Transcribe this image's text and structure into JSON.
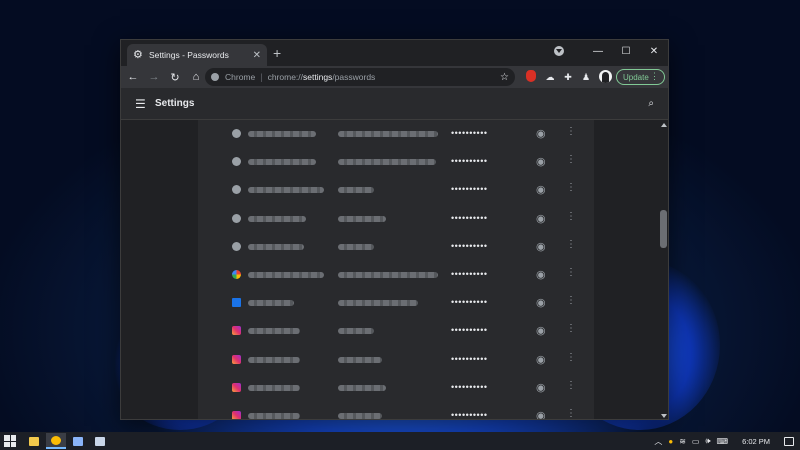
{
  "browser": {
    "tab_title": "Settings - Passwords",
    "omnibox_chip": "Chrome",
    "url_prefix": "chrome://",
    "url_bold": "settings",
    "url_suffix": "/passwords",
    "update_label": "Update"
  },
  "settings": {
    "title": "Settings"
  },
  "passwords": {
    "rows": [
      {
        "favicon": "globe-icon",
        "password_mask": "••••••••••"
      },
      {
        "favicon": "globe-icon",
        "password_mask": "••••••••••"
      },
      {
        "favicon": "globe-icon",
        "password_mask": "••••••••••"
      },
      {
        "favicon": "globe-icon",
        "password_mask": "••••••••••"
      },
      {
        "favicon": "globe-icon",
        "password_mask": "••••••••••"
      },
      {
        "favicon": "google-icon",
        "password_mask": "••••••••••"
      },
      {
        "favicon": "app-square-icon",
        "password_mask": "••••••••••"
      },
      {
        "favicon": "instagram-icon",
        "password_mask": "••••••••••"
      },
      {
        "favicon": "instagram-icon",
        "password_mask": "••••••••••"
      },
      {
        "favicon": "instagram-icon",
        "password_mask": "••••••••••"
      },
      {
        "favicon": "instagram-icon",
        "password_mask": "••••••••••"
      }
    ]
  },
  "taskbar": {
    "time": "6:02 PM"
  },
  "colors": {
    "accent_update": "#81c995",
    "window_bg": "#202124",
    "card_bg": "#292a2d"
  }
}
